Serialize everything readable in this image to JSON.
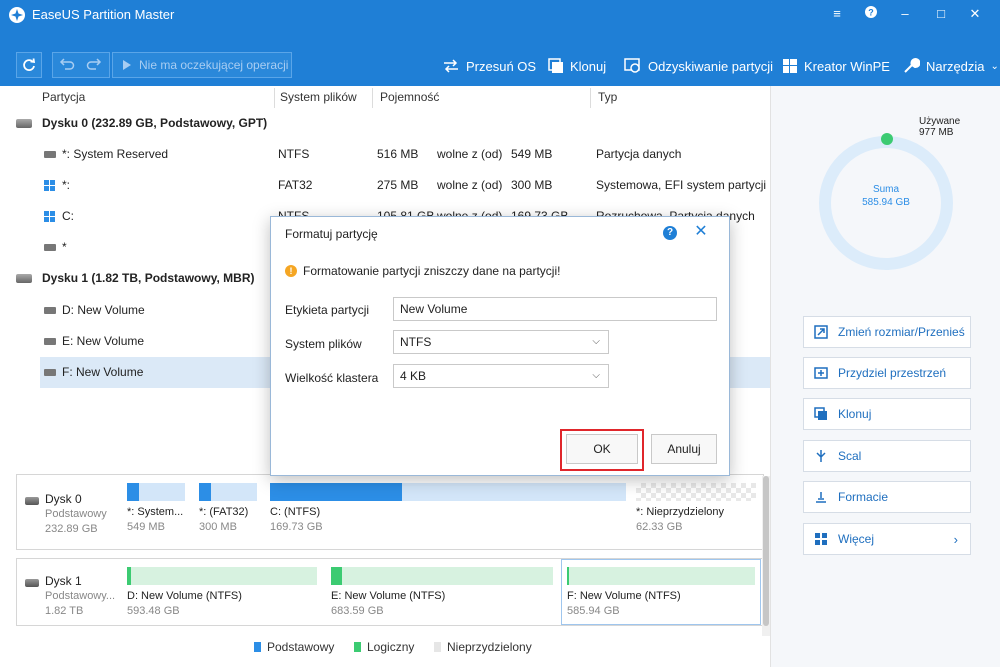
{
  "app": {
    "title": "EaseUS Partition Master"
  },
  "toolbar": {
    "pending": "Nie ma oczekującej operacji",
    "tools": [
      "Przesuń OS",
      "Klonuj",
      "Odzyskiwanie partycji",
      "Kreator WinPE",
      "Narzędzia"
    ]
  },
  "list": {
    "headers": {
      "partition": "Partycja",
      "fs": "System plików",
      "capacity": "Pojemność",
      "type": "Typ"
    },
    "disk0": "Dysku 0 (232.89 GB, Podstawowy, GPT)",
    "disk1": "Dysku 1 (1.82 TB, Podstawowy, MBR)",
    "rows": [
      {
        "name": "*: System Reserved",
        "fs": "NTFS",
        "used": "516 MB",
        "free_label": "wolne z (od)",
        "total": "549 MB",
        "type": "Partycja danych"
      },
      {
        "name": "*:",
        "fs": "FAT32",
        "used": "275 MB",
        "free_label": "wolne z (od)",
        "total": "300 MB",
        "type": "Systemowa, EFI system partycji"
      },
      {
        "name": "C:",
        "fs": "NTFS",
        "used": "105.81 GB",
        "free_label": "wolne z (od)",
        "total": "169.73 GB",
        "type": "Rozruchowa, Partycja danych"
      },
      {
        "name": "*"
      },
      {
        "name": "D: New Volume"
      },
      {
        "name": "E: New Volume"
      },
      {
        "name": "F: New Volume"
      }
    ]
  },
  "diskmap": {
    "disk0": {
      "name": "Dysk 0",
      "type": "Podstawowy",
      "size": "232.89 GB",
      "parts": [
        {
          "label": "*: System...",
          "size": "549 MB",
          "fill": 0.2
        },
        {
          "label": "*: (FAT32)",
          "size": "300 MB",
          "fill": 0.2
        },
        {
          "label": "C: (NTFS)",
          "size": "169.73 GB",
          "fill": 0.37
        },
        {
          "label": "*: Nieprzydzielony",
          "size": "62.33 GB",
          "fill": 0
        }
      ]
    },
    "disk1": {
      "name": "Dysk 1",
      "type": "Podstawowy...",
      "size": "1.82 TB",
      "parts": [
        {
          "label": "D: New Volume (NTFS)",
          "size": "593.48 GB",
          "fill": 0.02
        },
        {
          "label": "E: New Volume (NTFS)",
          "size": "683.59 GB",
          "fill": 0.05
        },
        {
          "label": "F: New Volume (NTFS)",
          "size": "585.94 GB",
          "fill": 0.01
        }
      ]
    },
    "legend": [
      "Podstawowy",
      "Logiczny",
      "Nieprzydzielony"
    ]
  },
  "side": {
    "used_label": "Używane",
    "used_value": "977 MB",
    "sum_label": "Suma",
    "sum_value": "585.94 GB",
    "actions": [
      "Zmień rozmiar/Przenieś",
      "Przydziel przestrzeń",
      "Klonuj",
      "Scal",
      "Formacie",
      "Więcej"
    ]
  },
  "dialog": {
    "title": "Formatuj partycję",
    "warning": "Formatowanie partycji zniszczy dane na partycji!",
    "label_field": "Etykieta partycji",
    "label_value": "New Volume",
    "fs_field": "System plików",
    "fs_value": "NTFS",
    "cluster_field": "Wielkość klastera",
    "cluster_value": "4 KB",
    "ok": "OK",
    "cancel": "Anuluj"
  },
  "colors": {
    "accent": "#1f7fd6",
    "primary_bar": "#2c8ee6",
    "logical_bar": "#3ccb72",
    "highlight": "#e0262b"
  }
}
